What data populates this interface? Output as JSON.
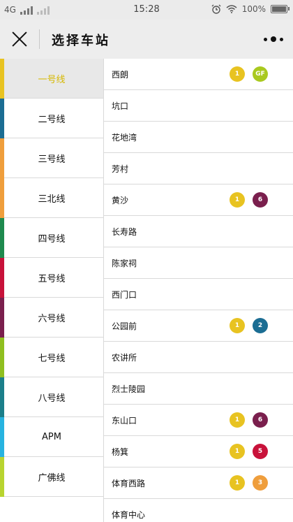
{
  "status_bar": {
    "network": "4G",
    "time": "15:28",
    "battery": "100%"
  },
  "header": {
    "title": "选择车站"
  },
  "lines": [
    {
      "label": "一号线",
      "color": "#e8c321",
      "active": true
    },
    {
      "label": "二号线",
      "color": "#1b6d93"
    },
    {
      "label": "三号线",
      "color": "#ef9e3c"
    },
    {
      "label": "三北线",
      "color": "#ef9e3c"
    },
    {
      "label": "四号线",
      "color": "#1e8a4e"
    },
    {
      "label": "五号线",
      "color": "#c8123a"
    },
    {
      "label": "六号线",
      "color": "#7a1f4d"
    },
    {
      "label": "七号线",
      "color": "#8fbf1f"
    },
    {
      "label": "八号线",
      "color": "#1b7f8a"
    },
    {
      "label": "APM",
      "color": "#27b3e0"
    },
    {
      "label": "广佛线",
      "color": "#b8d430"
    }
  ],
  "stations": [
    {
      "name": "西朗",
      "badges": [
        {
          "text": "1",
          "color": "#e8c321"
        },
        {
          "text": "GF",
          "color": "#a9c91f"
        }
      ]
    },
    {
      "name": "坑口",
      "badges": []
    },
    {
      "name": "花地湾",
      "badges": []
    },
    {
      "name": "芳村",
      "badges": []
    },
    {
      "name": "黄沙",
      "badges": [
        {
          "text": "1",
          "color": "#e8c321"
        },
        {
          "text": "6",
          "color": "#7a1f4d"
        }
      ]
    },
    {
      "name": "长寿路",
      "badges": []
    },
    {
      "name": "陈家祠",
      "badges": []
    },
    {
      "name": "西门口",
      "badges": []
    },
    {
      "name": "公园前",
      "badges": [
        {
          "text": "1",
          "color": "#e8c321"
        },
        {
          "text": "2",
          "color": "#1b6d93"
        }
      ]
    },
    {
      "name": "农讲所",
      "badges": []
    },
    {
      "name": "烈士陵园",
      "badges": []
    },
    {
      "name": "东山口",
      "badges": [
        {
          "text": "1",
          "color": "#e8c321"
        },
        {
          "text": "6",
          "color": "#7a1f4d"
        }
      ]
    },
    {
      "name": "杨箕",
      "badges": [
        {
          "text": "1",
          "color": "#e8c321"
        },
        {
          "text": "5",
          "color": "#c8123a"
        }
      ]
    },
    {
      "name": "体育西路",
      "badges": [
        {
          "text": "1",
          "color": "#e8c321"
        },
        {
          "text": "3",
          "color": "#ef9e3c"
        }
      ]
    },
    {
      "name": "体育中心",
      "badges": []
    }
  ]
}
